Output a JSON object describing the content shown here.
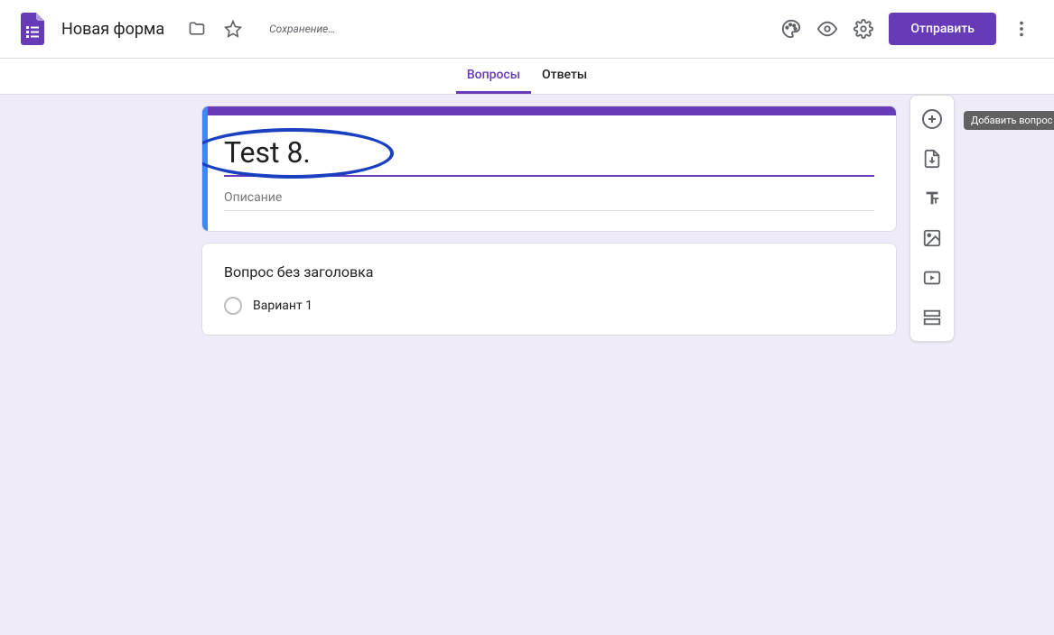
{
  "header": {
    "form_title": "Новая форма",
    "saving_status": "Сохранение…",
    "send_button": "Отправить"
  },
  "tabs": {
    "questions": "Вопросы",
    "responses": "Ответы"
  },
  "form": {
    "title_value": "Test 8.",
    "description_placeholder": "Описание"
  },
  "question": {
    "title": "Вопрос без заголовка",
    "option1": "Вариант 1"
  },
  "toolbar": {
    "tooltip_add_question": "Добавить вопрос"
  }
}
